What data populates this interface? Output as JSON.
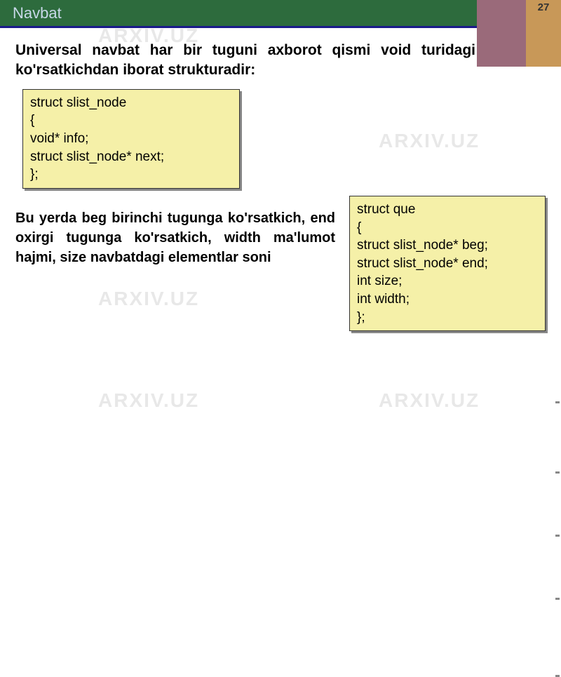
{
  "header": {
    "title": "Navbat",
    "page_number": "27"
  },
  "intro": "Universal navbat har bir tuguni axborot qismi void turidagi ko'rsatkichdan iborat strukturadir:",
  "code1": {
    "line1": " struct slist_node",
    "line2": "{",
    "line3": "void* info;",
    "line4": "struct slist_node* next;",
    "line5": "};"
  },
  "description": "Bu yerda beg birinchi tugunga ko'rsatkich, end oxirgi tugunga ko'rsatkich, width ma'lumot hajmi, size navbatdagi elementlar soni",
  "code2": {
    "line1": "struct que",
    "line2": "{",
    "line3": "struct slist_node* beg;",
    "line4": "struct slist_node* end;",
    "line5": "int size;",
    "line6": "int width;",
    "line7": "};"
  },
  "watermark": "ARXIV.UZ"
}
